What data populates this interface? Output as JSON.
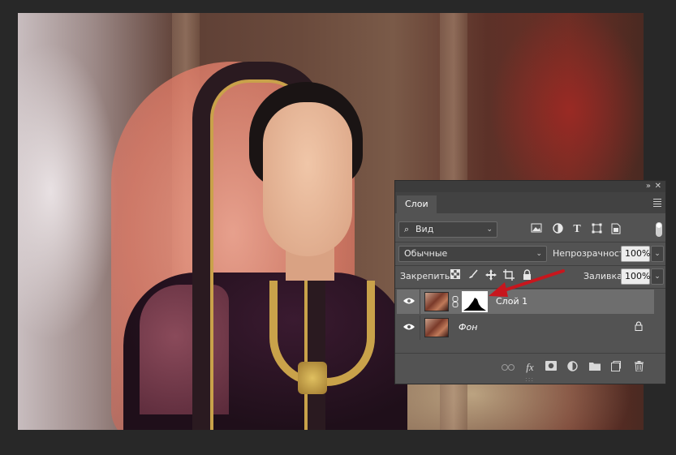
{
  "panel": {
    "tab_label": "Слои",
    "collapse_glyph": "»",
    "close_glyph": "✕",
    "menu_icon": "hamburger-menu-icon"
  },
  "filter": {
    "kind_label": "Вид",
    "search_icon": "⌕",
    "filter_icons": [
      "image-filter-icon",
      "adjustment-filter-icon",
      "type-filter-icon",
      "shape-filter-icon",
      "smart-object-filter-icon"
    ]
  },
  "blend": {
    "mode": "Обычные",
    "opacity_label": "Непрозрачность:",
    "opacity_value": "100%"
  },
  "lock": {
    "label": "Закрепить:",
    "icons": [
      "lock-transparent-pixels-icon",
      "lock-image-pixels-icon",
      "lock-position-icon",
      "prevent-autonest-icon",
      "lock-all-icon"
    ],
    "fill_label": "Заливка:",
    "fill_value": "100%"
  },
  "layers": [
    {
      "name": "Слой 1",
      "selected": true,
      "has_mask": true,
      "italic": false,
      "locked": false
    },
    {
      "name": "Фон",
      "selected": false,
      "has_mask": false,
      "italic": true,
      "locked": true
    }
  ],
  "bottom_icons": [
    "link-layers-icon",
    "fx-icon",
    "add-mask-icon",
    "adjustment-layer-icon",
    "group-folder-icon",
    "new-layer-icon",
    "trash-icon"
  ],
  "bottom_fx_label": "fx",
  "annotation": {
    "arrow_color": "#c8161d"
  }
}
